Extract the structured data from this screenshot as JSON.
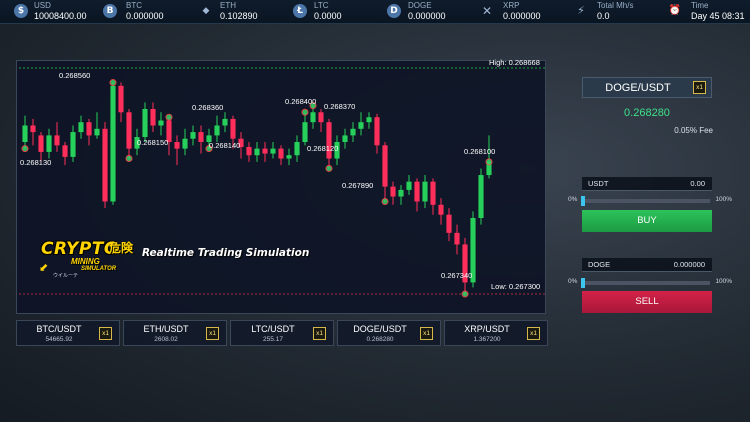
{
  "topbar": {
    "items": [
      {
        "label": "USD",
        "value": "10008400.00",
        "icon": "dollar-icon",
        "glyph": "$"
      },
      {
        "label": "BTC",
        "value": "0.000000",
        "icon": "bitcoin-icon",
        "glyph": "B"
      },
      {
        "label": "ETH",
        "value": "0.102890",
        "icon": "ethereum-icon",
        "glyph": "◆"
      },
      {
        "label": "LTC",
        "value": "0.0000",
        "icon": "litecoin-icon",
        "glyph": "Ł"
      },
      {
        "label": "DOGE",
        "value": "0.000000",
        "icon": "dogecoin-icon",
        "glyph": "D"
      },
      {
        "label": "XRP",
        "value": "0.000000",
        "icon": "xrp-icon",
        "glyph": "✕"
      },
      {
        "label": "Total Mh/s",
        "value": "0.0",
        "icon": "lightning-icon",
        "glyph": "⚡"
      },
      {
        "label": "Time",
        "value": "Day 45 08:31",
        "icon": "alarm-clock-icon",
        "glyph": "⏰"
      }
    ]
  },
  "chart": {
    "high_label": "High: 0.268668",
    "low_label": "Low: 0.267300",
    "annotations": [
      "0.268560",
      "0.268130",
      "0.268150",
      "0.268360",
      "0.268140",
      "0.268400",
      "0.268370",
      "0.268120",
      "0.267890",
      "0.268100",
      "0.267340"
    ]
  },
  "chart_data": {
    "type": "candlestick",
    "pair": "DOGE/USDT",
    "high": 0.268668,
    "low": 0.2673,
    "colors": {
      "up": "#26d05a",
      "down": "#ff2e5a"
    },
    "candles": [
      {
        "o": 0.26822,
        "c": 0.26832,
        "h": 0.26838,
        "l": 0.26818
      },
      {
        "o": 0.26832,
        "c": 0.26828,
        "h": 0.26836,
        "l": 0.2682
      },
      {
        "o": 0.26826,
        "c": 0.26816,
        "h": 0.26828,
        "l": 0.2681
      },
      {
        "o": 0.26816,
        "c": 0.26826,
        "h": 0.2683,
        "l": 0.26812
      },
      {
        "o": 0.26826,
        "c": 0.2682,
        "h": 0.26834,
        "l": 0.26816
      },
      {
        "o": 0.2682,
        "c": 0.26813,
        "h": 0.26822,
        "l": 0.26808
      },
      {
        "o": 0.26813,
        "c": 0.26828,
        "h": 0.26832,
        "l": 0.2681
      },
      {
        "o": 0.26828,
        "c": 0.26834,
        "h": 0.26838,
        "l": 0.26824
      },
      {
        "o": 0.26834,
        "c": 0.26826,
        "h": 0.26836,
        "l": 0.2682
      },
      {
        "o": 0.26826,
        "c": 0.2683,
        "h": 0.2684,
        "l": 0.26824
      },
      {
        "o": 0.2683,
        "c": 0.26786,
        "h": 0.26834,
        "l": 0.26782
      },
      {
        "o": 0.26786,
        "c": 0.26856,
        "h": 0.26858,
        "l": 0.26784
      },
      {
        "o": 0.26856,
        "c": 0.2684,
        "h": 0.26858,
        "l": 0.26834
      },
      {
        "o": 0.2684,
        "c": 0.26818,
        "h": 0.26842,
        "l": 0.26812
      },
      {
        "o": 0.26818,
        "c": 0.26825,
        "h": 0.2683,
        "l": 0.26814
      },
      {
        "o": 0.26825,
        "c": 0.26842,
        "h": 0.26846,
        "l": 0.26822
      },
      {
        "o": 0.26842,
        "c": 0.26832,
        "h": 0.26846,
        "l": 0.26828
      },
      {
        "o": 0.26832,
        "c": 0.26835,
        "h": 0.2684,
        "l": 0.26826
      },
      {
        "o": 0.26835,
        "c": 0.26822,
        "h": 0.26837,
        "l": 0.26814
      },
      {
        "o": 0.26822,
        "c": 0.26818,
        "h": 0.26826,
        "l": 0.26808
      },
      {
        "o": 0.26818,
        "c": 0.26824,
        "h": 0.2683,
        "l": 0.26814
      },
      {
        "o": 0.26824,
        "c": 0.26828,
        "h": 0.26832,
        "l": 0.2682
      },
      {
        "o": 0.26828,
        "c": 0.26822,
        "h": 0.26832,
        "l": 0.26815
      },
      {
        "o": 0.26822,
        "c": 0.26826,
        "h": 0.2683,
        "l": 0.26818
      },
      {
        "o": 0.26826,
        "c": 0.26832,
        "h": 0.26838,
        "l": 0.26822
      },
      {
        "o": 0.26832,
        "c": 0.26836,
        "h": 0.2684,
        "l": 0.26828
      },
      {
        "o": 0.26836,
        "c": 0.26824,
        "h": 0.26838,
        "l": 0.26818
      },
      {
        "o": 0.26824,
        "c": 0.26819,
        "h": 0.26828,
        "l": 0.26812
      },
      {
        "o": 0.26819,
        "c": 0.26814,
        "h": 0.26822,
        "l": 0.2681
      },
      {
        "o": 0.26814,
        "c": 0.26818,
        "h": 0.26822,
        "l": 0.2681
      },
      {
        "o": 0.26818,
        "c": 0.26815,
        "h": 0.26822,
        "l": 0.2681
      },
      {
        "o": 0.26815,
        "c": 0.26818,
        "h": 0.26822,
        "l": 0.26812
      },
      {
        "o": 0.26818,
        "c": 0.26812,
        "h": 0.2682,
        "l": 0.26808
      },
      {
        "o": 0.26812,
        "c": 0.26814,
        "h": 0.26818,
        "l": 0.26808
      },
      {
        "o": 0.26814,
        "c": 0.26822,
        "h": 0.26826,
        "l": 0.2681
      },
      {
        "o": 0.26822,
        "c": 0.26834,
        "h": 0.2684,
        "l": 0.2682
      },
      {
        "o": 0.26834,
        "c": 0.2684,
        "h": 0.26844,
        "l": 0.2683
      },
      {
        "o": 0.2684,
        "c": 0.26834,
        "h": 0.26842,
        "l": 0.26828
      },
      {
        "o": 0.26834,
        "c": 0.26812,
        "h": 0.26836,
        "l": 0.26806
      },
      {
        "o": 0.26812,
        "c": 0.26822,
        "h": 0.26826,
        "l": 0.26808
      },
      {
        "o": 0.26822,
        "c": 0.26826,
        "h": 0.2683,
        "l": 0.26818
      },
      {
        "o": 0.26826,
        "c": 0.2683,
        "h": 0.26834,
        "l": 0.26822
      },
      {
        "o": 0.2683,
        "c": 0.26834,
        "h": 0.2684,
        "l": 0.26826
      },
      {
        "o": 0.26834,
        "c": 0.26837,
        "h": 0.2684,
        "l": 0.2683
      },
      {
        "o": 0.26837,
        "c": 0.2682,
        "h": 0.26839,
        "l": 0.26815
      },
      {
        "o": 0.2682,
        "c": 0.26795,
        "h": 0.26822,
        "l": 0.26786
      },
      {
        "o": 0.26795,
        "c": 0.26789,
        "h": 0.26798,
        "l": 0.26784
      },
      {
        "o": 0.26789,
        "c": 0.26793,
        "h": 0.26796,
        "l": 0.26784
      },
      {
        "o": 0.26793,
        "c": 0.26798,
        "h": 0.26802,
        "l": 0.2679
      },
      {
        "o": 0.26798,
        "c": 0.26786,
        "h": 0.268,
        "l": 0.2678
      },
      {
        "o": 0.26786,
        "c": 0.26798,
        "h": 0.26802,
        "l": 0.26782
      },
      {
        "o": 0.26798,
        "c": 0.26784,
        "h": 0.268,
        "l": 0.26778
      },
      {
        "o": 0.26784,
        "c": 0.26778,
        "h": 0.26788,
        "l": 0.26772
      },
      {
        "o": 0.26778,
        "c": 0.26767,
        "h": 0.26782,
        "l": 0.26762
      },
      {
        "o": 0.26767,
        "c": 0.2676,
        "h": 0.26772,
        "l": 0.26754
      },
      {
        "o": 0.2676,
        "c": 0.26737,
        "h": 0.26764,
        "l": 0.2673
      },
      {
        "o": 0.26737,
        "c": 0.26776,
        "h": 0.2678,
        "l": 0.26734
      },
      {
        "o": 0.26776,
        "c": 0.26802,
        "h": 0.26806,
        "l": 0.26772
      },
      {
        "o": 0.26802,
        "c": 0.2681,
        "h": 0.26826,
        "l": 0.268
      }
    ]
  },
  "logo": {
    "crypto": "CRYPTO",
    "kanji": "危険",
    "mining": "MINING",
    "simulator": "SIMULATOR",
    "small": "ウイルーテ",
    "tagline": "Realtime Trading Simulation"
  },
  "pairs": [
    {
      "name": "BTC/USDT",
      "price": "54665.92",
      "mult": "x1"
    },
    {
      "name": "ETH/USDT",
      "price": "2608.02",
      "mult": "x1"
    },
    {
      "name": "LTC/USDT",
      "price": "255.17",
      "mult": "x1"
    },
    {
      "name": "DOGE/USDT",
      "price": "0.268280",
      "mult": "x1"
    },
    {
      "name": "XRP/USDT",
      "price": "1.367200",
      "mult": "x1"
    }
  ],
  "trade": {
    "pair": "DOGE/USDT",
    "mult": "x1",
    "price": "0.268280",
    "fee": "0.05% Fee",
    "usdt_label": "USDT",
    "usdt_value": "0.00",
    "doge_label": "DOGE",
    "doge_value": "0.000000",
    "slider_min": "0%",
    "slider_max": "100%",
    "buy_slider_value": 0,
    "sell_slider_value": 0,
    "buy_label": "BUY",
    "sell_label": "SELL",
    "buy_color": "#28b454",
    "sell_color": "#c81c42"
  }
}
